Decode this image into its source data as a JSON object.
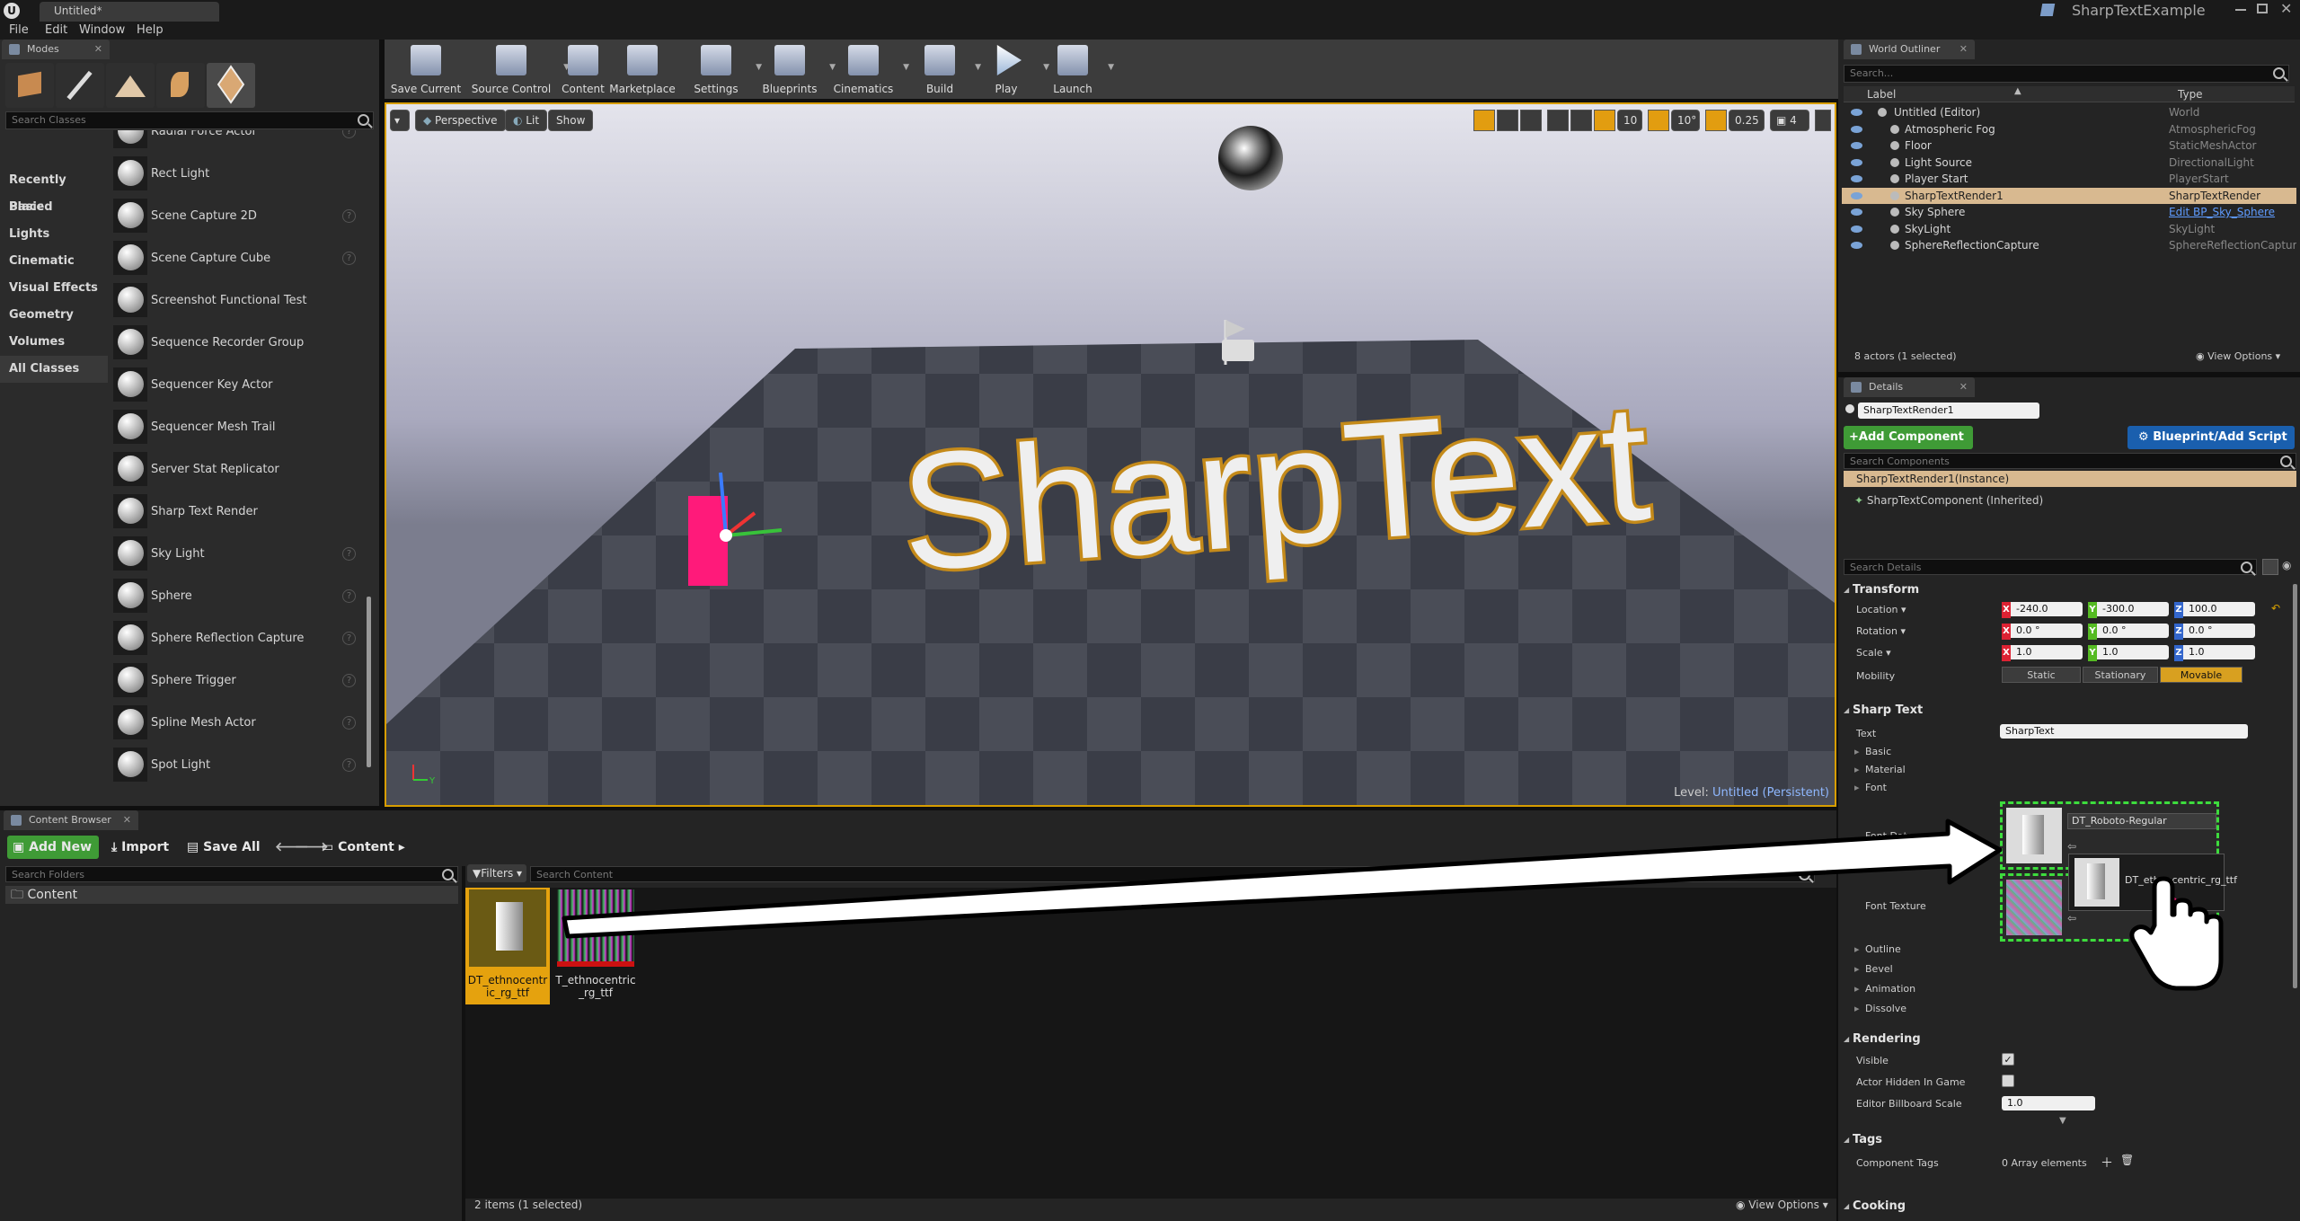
{
  "window": {
    "tab_title": "Untitled*",
    "project_name": "SharpTextExample"
  },
  "menu": [
    "File",
    "Edit",
    "Window",
    "Help"
  ],
  "modes": {
    "tab": "Modes",
    "search_placeholder": "Search Classes",
    "categories": [
      "Recently Placed",
      "Basic",
      "Lights",
      "Cinematic",
      "Visual Effects",
      "Geometry",
      "Volumes",
      "All Classes"
    ],
    "selected_category": "All Classes",
    "actors": [
      {
        "label": "Radial Force Actor",
        "help": true
      },
      {
        "label": "Rect Light",
        "help": false
      },
      {
        "label": "Scene Capture 2D",
        "help": true
      },
      {
        "label": "Scene Capture Cube",
        "help": true
      },
      {
        "label": "Screenshot Functional Test",
        "help": false
      },
      {
        "label": "Sequence Recorder Group",
        "help": false
      },
      {
        "label": "Sequencer Key Actor",
        "help": false
      },
      {
        "label": "Sequencer Mesh Trail",
        "help": false
      },
      {
        "label": "Server Stat Replicator",
        "help": false
      },
      {
        "label": "Sharp Text Render",
        "help": false
      },
      {
        "label": "Sky Light",
        "help": true
      },
      {
        "label": "Sphere",
        "help": true
      },
      {
        "label": "Sphere Reflection Capture",
        "help": true
      },
      {
        "label": "Sphere Trigger",
        "help": true
      },
      {
        "label": "Spline Mesh Actor",
        "help": true
      },
      {
        "label": "Spot Light",
        "help": true
      }
    ]
  },
  "toolbar": [
    {
      "label": "Save Current",
      "dropdown": false
    },
    {
      "label": "Source Control",
      "dropdown": true
    },
    {
      "label": "Content",
      "dropdown": false
    },
    {
      "label": "Marketplace",
      "dropdown": false
    },
    {
      "label": "Settings",
      "dropdown": true
    },
    {
      "label": "Blueprints",
      "dropdown": true
    },
    {
      "label": "Cinematics",
      "dropdown": true
    },
    {
      "label": "Build",
      "dropdown": true
    },
    {
      "label": "Play",
      "dropdown": true
    },
    {
      "label": "Launch",
      "dropdown": true
    }
  ],
  "viewport": {
    "perspective": "Perspective",
    "lit": "Lit",
    "show": "Show",
    "grid_snap": "10",
    "rot_snap": "10°",
    "scale_snap": "0.25",
    "camera_speed": "4",
    "text_3d": "SharpText",
    "level_label": "Level:",
    "level_name": "Untitled (Persistent)"
  },
  "outliner": {
    "tab": "World Outliner",
    "search_placeholder": "Search...",
    "col_label": "Label",
    "col_type": "Type",
    "rows": [
      {
        "name": "Untitled (Editor)",
        "type": "World",
        "indent": 0,
        "selected": false,
        "link": false
      },
      {
        "name": "Atmospheric Fog",
        "type": "AtmosphericFog",
        "indent": 1,
        "selected": false,
        "link": false
      },
      {
        "name": "Floor",
        "type": "StaticMeshActor",
        "indent": 1,
        "selected": false,
        "link": false
      },
      {
        "name": "Light Source",
        "type": "DirectionalLight",
        "indent": 1,
        "selected": false,
        "link": false
      },
      {
        "name": "Player Start",
        "type": "PlayerStart",
        "indent": 1,
        "selected": false,
        "link": false
      },
      {
        "name": "SharpTextRender1",
        "type": "SharpTextRender",
        "indent": 1,
        "selected": true,
        "link": false
      },
      {
        "name": "Sky Sphere",
        "type": "Edit BP_Sky_Sphere",
        "indent": 1,
        "selected": false,
        "link": true
      },
      {
        "name": "SkyLight",
        "type": "SkyLight",
        "indent": 1,
        "selected": false,
        "link": false
      },
      {
        "name": "SphereReflectionCapture",
        "type": "SphereReflectionCapture",
        "indent": 1,
        "selected": false,
        "link": false
      }
    ],
    "footer": "8 actors (1 selected)",
    "view_options": "View Options"
  },
  "details": {
    "tab": "Details",
    "name_value": "SharpTextRender1",
    "add_component": "+Add Component",
    "blueprint_btn": "Blueprint/Add Script",
    "search_components": "Search Components",
    "comp_instance": "SharpTextRender1(Instance)",
    "comp_inherited": "SharpTextComponent (Inherited)",
    "search_details": "Search Details",
    "transform": {
      "header": "Transform",
      "location_label": "Location",
      "rotation_label": "Rotation",
      "scale_label": "Scale",
      "mobility_label": "Mobility",
      "location": [
        "-240.0",
        "-300.0",
        "100.0"
      ],
      "rotation": [
        "0.0 °",
        "0.0 °",
        "0.0 °"
      ],
      "scale": [
        "1.0",
        "1.0",
        "1.0"
      ],
      "mobility": [
        "Static",
        "Stationary",
        "Movable"
      ]
    },
    "sharp_text": {
      "header": "Sharp Text",
      "text_label": "Text",
      "text_value": "SharpText",
      "basic": "Basic",
      "material": "Material",
      "font": "Font",
      "font_data_label": "Font Data",
      "font_data_value": "DT_Roboto-Regular",
      "font_texture_label": "Font Texture",
      "drag_tooltip": "DT_ethnocentric_rg_ttf",
      "outline": "Outline",
      "bevel": "Bevel",
      "animation": "Animation",
      "dissolve": "Dissolve"
    },
    "rendering": {
      "header": "Rendering",
      "visible": "Visible",
      "hidden_in_game": "Actor Hidden In Game",
      "billboard_scale": "Editor Billboard Scale",
      "billboard_value": "1.0"
    },
    "tags": {
      "header": "Tags",
      "component_tags": "Component Tags",
      "array_text": "0 Array elements"
    },
    "cooking": {
      "header": "Cooking"
    }
  },
  "content_browser": {
    "tab": "Content Browser",
    "add_new": "Add New",
    "import": "Import",
    "save_all": "Save All",
    "path_root": "Content",
    "folder_search": "Search Folders",
    "folder_root": "Content",
    "filters": "Filters",
    "search_content": "Search Content",
    "assets": [
      {
        "name": "DT_ethnocentric_rg_ttf",
        "selected": true
      },
      {
        "name": "T_ethnocentric_rg_ttf",
        "selected": false
      }
    ],
    "status": "2 items (1 selected)",
    "view_options": "View Options"
  }
}
